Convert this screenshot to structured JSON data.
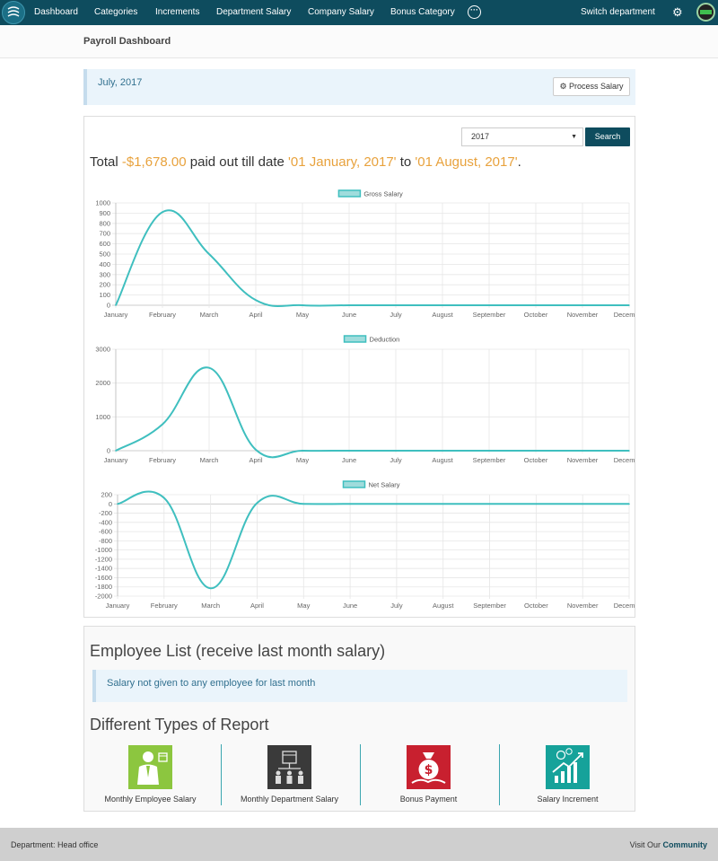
{
  "nav": {
    "items": [
      {
        "id": "dashboard",
        "label": "Dashboard"
      },
      {
        "id": "categories",
        "label": "Categories"
      },
      {
        "id": "increments",
        "label": "Increments"
      },
      {
        "id": "department-salary",
        "label": "Department Salary"
      },
      {
        "id": "company-salary",
        "label": "Company Salary"
      },
      {
        "id": "bonus-category",
        "label": "Bonus Category"
      }
    ],
    "more_icon": "more-icon",
    "switch_department": "Switch department",
    "settings_icon": "gear-icon",
    "brand_color": "#0e4c5e"
  },
  "page": {
    "title": "Payroll Dashboard"
  },
  "month_bar": {
    "date": "July, 2017",
    "process_button": "Process Salary",
    "process_icon": "cogs-icon"
  },
  "filter": {
    "year": "2017",
    "search_label": "Search"
  },
  "summary": {
    "prefix": "Total ",
    "amount": "-$1,678.00",
    "mid": " paid out till date ",
    "start": "'01 January, 2017'",
    "to": " to ",
    "end": "'01 August, 2017'",
    "suffix": ".",
    "highlight_color": "#e8a23d"
  },
  "chart_data": [
    {
      "type": "line",
      "categories": [
        "January",
        "February",
        "March",
        "April",
        "May",
        "June",
        "July",
        "August",
        "September",
        "October",
        "November",
        "December"
      ],
      "series": [
        {
          "name": "Gross Salary",
          "values": [
            0,
            910,
            500,
            50,
            0,
            0,
            0,
            0,
            0,
            0,
            0,
            0
          ]
        }
      ],
      "ylim": [
        0,
        1000
      ],
      "yticks": [
        0,
        100,
        200,
        300,
        400,
        500,
        600,
        700,
        800,
        900,
        1000
      ],
      "legend": "top",
      "grid": true,
      "color": "#3fbfbf"
    },
    {
      "type": "line",
      "categories": [
        "January",
        "February",
        "March",
        "April",
        "May",
        "June",
        "July",
        "August",
        "September",
        "October",
        "November",
        "December"
      ],
      "series": [
        {
          "name": "Deduction",
          "values": [
            0,
            780,
            2450,
            30,
            0,
            0,
            0,
            0,
            0,
            0,
            0,
            0
          ]
        }
      ],
      "ylim": [
        0,
        3000
      ],
      "yticks": [
        0,
        1000,
        2000,
        3000
      ],
      "legend": "top",
      "grid": true,
      "color": "#3fbfbf"
    },
    {
      "type": "line",
      "categories": [
        "January",
        "February",
        "March",
        "April",
        "May",
        "June",
        "July",
        "August",
        "September",
        "October",
        "November",
        "December"
      ],
      "series": [
        {
          "name": "Net Salary",
          "values": [
            0,
            130,
            -1830,
            20,
            0,
            0,
            0,
            0,
            0,
            0,
            0,
            0
          ]
        }
      ],
      "ylim": [
        -2000,
        200
      ],
      "yticks": [
        200,
        0,
        -200,
        -400,
        -600,
        -800,
        -1000,
        -1200,
        -1400,
        -1600,
        -1800,
        -2000
      ],
      "legend": "top",
      "grid": true,
      "color": "#3fbfbf"
    }
  ],
  "employee_list": {
    "title": "Employee List (receive last month salary)",
    "message": "Salary not given to any employee for last month"
  },
  "reports": {
    "title": "Different Types of Report",
    "items": [
      {
        "label": "Monthly Employee Salary",
        "icon": "employee-icon",
        "color": "#8cc63f"
      },
      {
        "label": "Monthly Department Salary",
        "icon": "department-icon",
        "color": "#3a3a3a"
      },
      {
        "label": "Bonus Payment",
        "icon": "money-bag-icon",
        "color": "#c8202f"
      },
      {
        "label": "Salary Increment",
        "icon": "growth-chart-icon",
        "color": "#16a29a"
      }
    ]
  },
  "footer": {
    "department": "Department: Head office",
    "visit": "Visit Our ",
    "community": "Community"
  }
}
